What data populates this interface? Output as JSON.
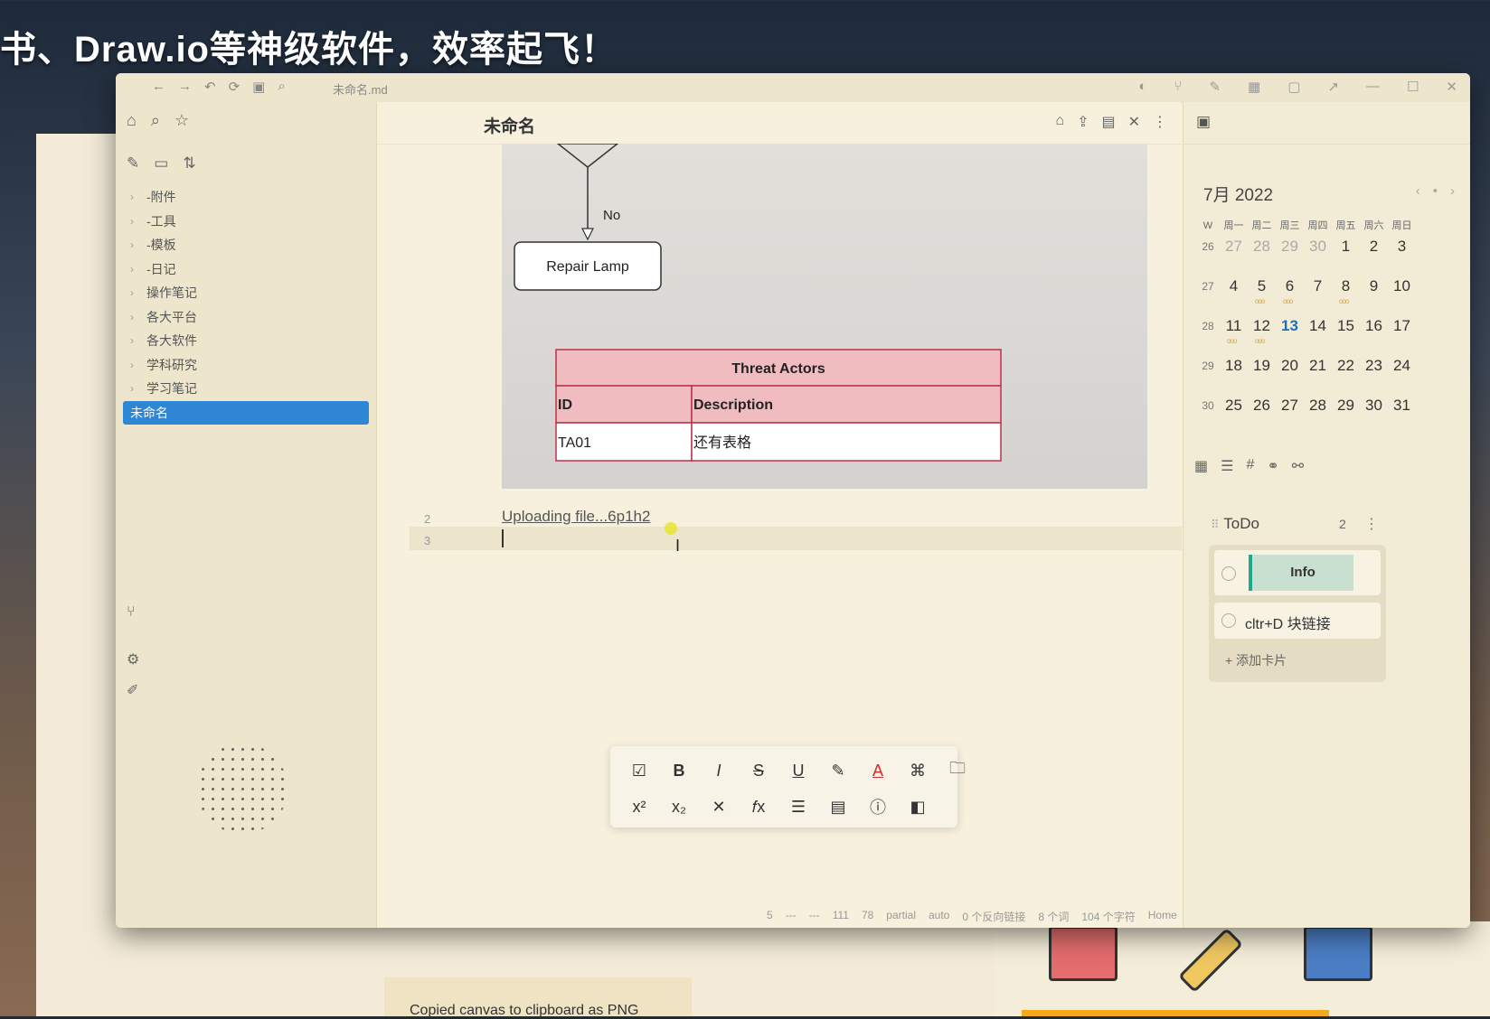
{
  "caption": "书、Draw.io等神级软件，效率起飞！",
  "titlebar": {
    "filename": "未命名.md",
    "nav_icons": [
      "←",
      "→",
      "↶",
      "⟳",
      "▣",
      "⌕"
    ],
    "right_icons": [
      "◐",
      "⑂",
      "✎",
      "▦",
      "▢",
      "↗",
      "—",
      "☐",
      "✕"
    ]
  },
  "sidebar": {
    "tree": [
      {
        "label": "-附件",
        "chevron": "›"
      },
      {
        "label": "-工具",
        "chevron": "›"
      },
      {
        "label": "-模板",
        "chevron": "›"
      },
      {
        "label": "-日记",
        "chevron": "›"
      },
      {
        "label": "操作笔记",
        "chevron": "›"
      },
      {
        "label": "各大平台",
        "chevron": "›"
      },
      {
        "label": "各大软件",
        "chevron": "›"
      },
      {
        "label": "学科研究",
        "chevron": "›"
      },
      {
        "label": "学习笔记",
        "chevron": "›"
      },
      {
        "label": "未命名",
        "active": true
      }
    ]
  },
  "editor": {
    "title": "未命名",
    "diagram": {
      "branch_label": "No",
      "process_box": "Repair Lamp",
      "table_title": "Threat Actors",
      "col1": "ID",
      "col2": "Description",
      "row_id": "TA01",
      "row_desc": "还有表格"
    },
    "line2_num": "2",
    "line2_text": "Uploading file...6p1h2",
    "line3_num": "3"
  },
  "toolbar": {
    "row1": [
      "☑",
      "B",
      "I",
      "S",
      "U",
      "✎",
      "A",
      "⌘",
      "🗀"
    ],
    "row2": [
      "x²",
      "x₂",
      "✕",
      "𝑓x",
      "☰",
      "▤",
      "ⓘ",
      "◧"
    ]
  },
  "status": [
    "5",
    "---",
    "---",
    "111",
    "78",
    "partial",
    "auto",
    "0 个反向链接",
    "8 个词",
    "104 个字符",
    "Home"
  ],
  "calendar": {
    "title": "7月 2022",
    "headers": [
      "W",
      "周一",
      "周二",
      "周三",
      "周四",
      "周五",
      "周六",
      "周日"
    ],
    "weeks": [
      {
        "w": "26",
        "days": [
          "27",
          "28",
          "29",
          "30",
          "1",
          "2",
          "3"
        ]
      },
      {
        "w": "27",
        "days": [
          "4",
          "5",
          "6",
          "7",
          "8",
          "9",
          "10"
        ]
      },
      {
        "w": "28",
        "days": [
          "11",
          "12",
          "13",
          "14",
          "15",
          "16",
          "17"
        ]
      },
      {
        "w": "29",
        "days": [
          "18",
          "19",
          "20",
          "21",
          "22",
          "23",
          "24"
        ]
      },
      {
        "w": "30",
        "days": [
          "25",
          "26",
          "27",
          "28",
          "29",
          "30",
          "31"
        ]
      }
    ]
  },
  "todo": {
    "title": "ToDo",
    "count": "2",
    "cards": [
      "Info",
      "cltr+D 块链接"
    ],
    "add": "+ 添加卡片"
  },
  "background": {
    "toast": "Copied canvas to clipboard as PNG"
  },
  "colors": {
    "accent": "#2e86d4",
    "table_header": "#f0bcc0",
    "table_border": "#b8334a",
    "today": "#1d6fb8",
    "info_bar": "#1fa88c"
  }
}
